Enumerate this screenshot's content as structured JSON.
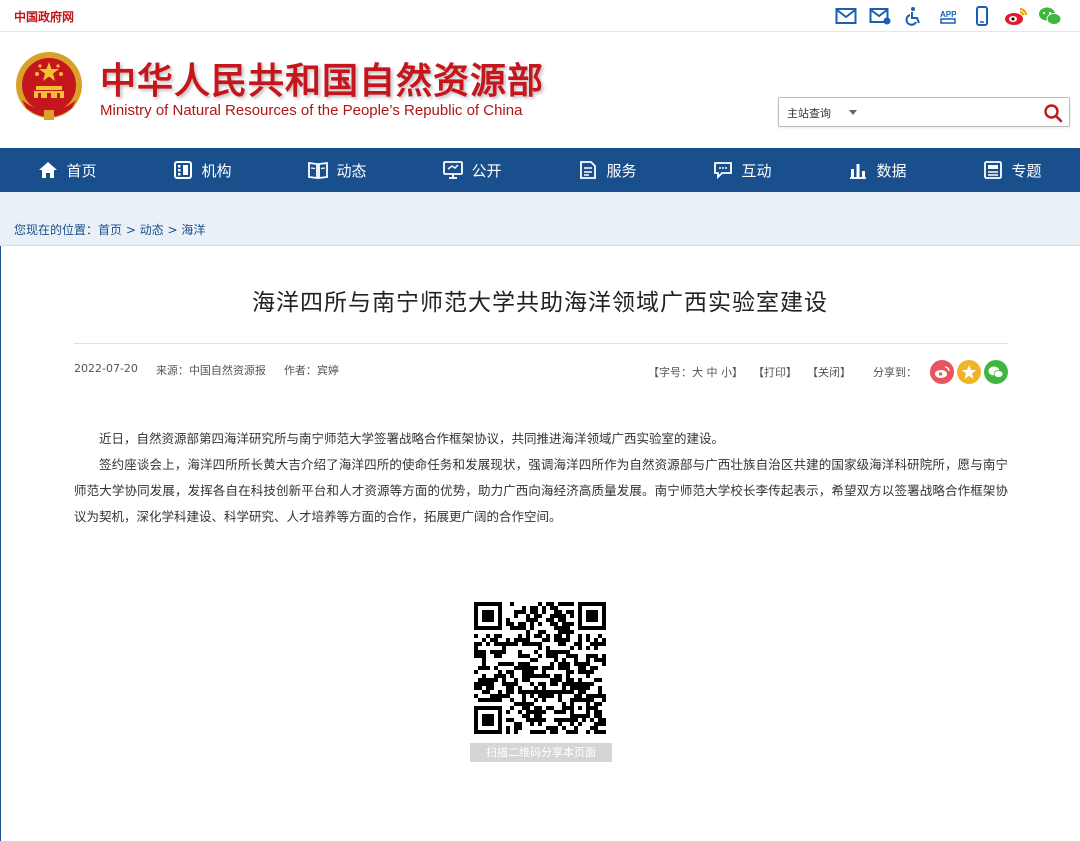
{
  "topbar": {
    "gov_link": "中国政府网",
    "icons": [
      "mail-icon",
      "mail-notify-icon",
      "accessibility-icon",
      "app-icon",
      "mobile-icon",
      "weibo-icon",
      "wechat-icon"
    ]
  },
  "header": {
    "title": "中华人民共和国自然资源部",
    "subtitle": "Ministry of Natural Resources of the People’s Republic of China",
    "search": {
      "scope": "主站查询",
      "value": "",
      "placeholder": ""
    }
  },
  "nav": {
    "items": [
      {
        "label": "首页",
        "icon": "home-icon"
      },
      {
        "label": "机构",
        "icon": "org-icon"
      },
      {
        "label": "动态",
        "icon": "news-icon"
      },
      {
        "label": "公开",
        "icon": "public-icon"
      },
      {
        "label": "服务",
        "icon": "service-icon"
      },
      {
        "label": "互动",
        "icon": "chat-icon"
      },
      {
        "label": "数据",
        "icon": "chart-icon"
      },
      {
        "label": "专题",
        "icon": "topic-icon"
      }
    ]
  },
  "breadcrumb": {
    "prefix": "您现在的位置：",
    "items": [
      "首页",
      "动态",
      "海洋"
    ],
    "separator": " > "
  },
  "article": {
    "title": "海洋四所与南宁师范大学共助海洋领域广西实验室建设",
    "date": "2022-07-20",
    "source_label": "来源：",
    "source": "中国自然资源报",
    "author_label": "作者：",
    "author": "宾婷",
    "font_size_label": "【字号：",
    "font_large": "大",
    "font_medium": "中",
    "font_small": "小",
    "font_close": "】",
    "print": "【打印】",
    "close": "【关闭】",
    "share_label": "分享到：",
    "paragraphs": [
      "近日，自然资源部第四海洋研究所与南宁师范大学签署战略合作框架协议，共同推进海洋领域广西实验室的建设。",
      "签约座谈会上，海洋四所所长黄大吉介绍了海洋四所的使命任务和发展现状，强调海洋四所作为自然资源部与广西壮族自治区共建的国家级海洋科研院所，愿与南宁师范大学协同发展，发挥各自在科技创新平台和人才资源等方面的优势，助力广西向海经济高质量发展。南宁师范大学校长李传起表示，希望双方以签署战略合作框架协议为契机，深化学科建设、科学研究、人才培养等方面的合作，拓展更广阔的合作空间。"
    ],
    "qr_caption": "扫描二维码分享本页面"
  },
  "colors": {
    "brand_red": "#c4161c",
    "nav_blue": "#1a4f8e",
    "crumb_bg": "#eaf0f7"
  }
}
